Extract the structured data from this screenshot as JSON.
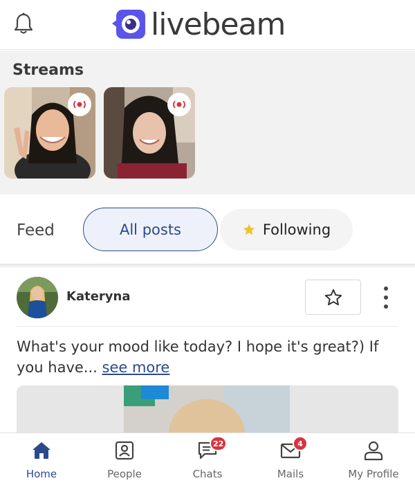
{
  "header": {
    "brand": "livebeam",
    "colors": {
      "brand": "#5a55e8",
      "accent": "#2a4a8d"
    }
  },
  "streams": {
    "title": "Streams",
    "items": [
      {
        "live": true,
        "icon": "live-broadcast-icon"
      },
      {
        "live": true,
        "icon": "live-broadcast-icon"
      }
    ]
  },
  "feed": {
    "label": "Feed",
    "tabs": [
      {
        "label": "All posts",
        "selected": true
      },
      {
        "label": "Following",
        "selected": false,
        "icon": "star-icon"
      }
    ]
  },
  "post": {
    "author": "Kateryna",
    "text": "What's your mood like today? I hope it's great?) If you have...",
    "see_more": "see more"
  },
  "nav": {
    "items": [
      {
        "label": "Home",
        "icon": "home-icon",
        "active": true
      },
      {
        "label": "People",
        "icon": "people-icon",
        "active": false
      },
      {
        "label": "Chats",
        "icon": "chat-icon",
        "badge": "22"
      },
      {
        "label": "Mails",
        "icon": "mail-icon",
        "badge": "4"
      },
      {
        "label": "My Profile",
        "icon": "profile-icon"
      }
    ]
  }
}
